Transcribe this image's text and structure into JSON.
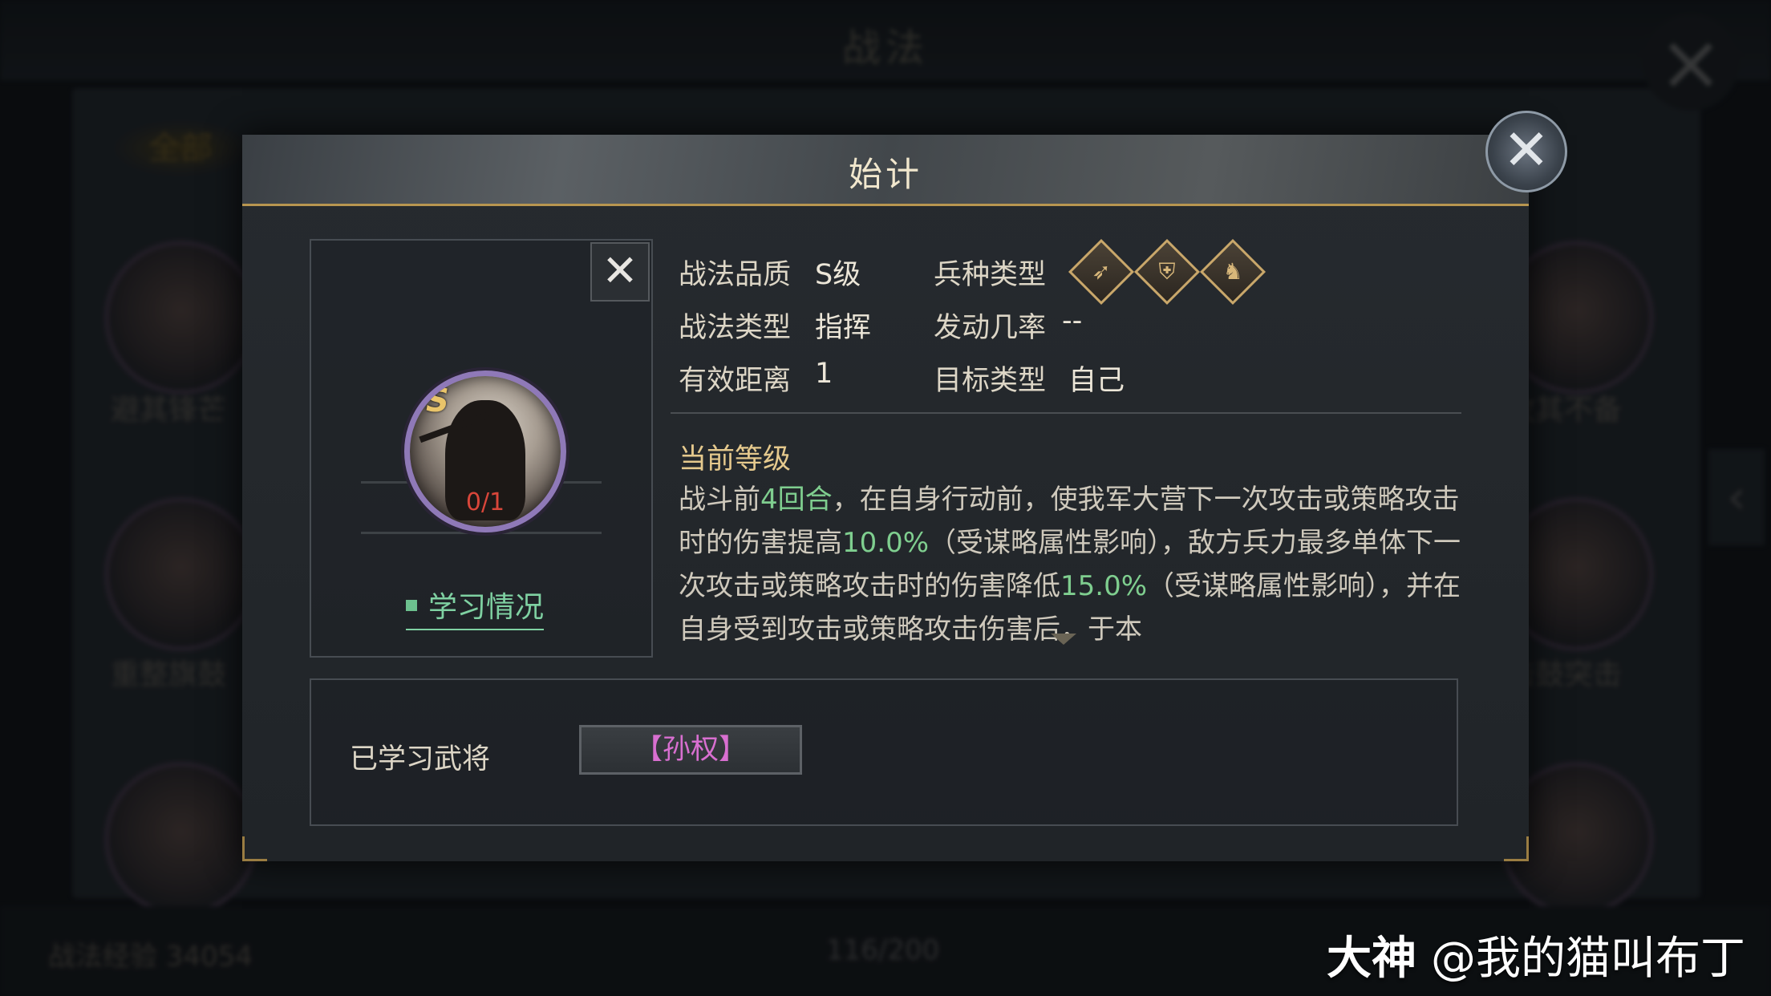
{
  "background": {
    "title": "战法",
    "tab_all": "全部",
    "cards": [
      {
        "label": "避其锋芒"
      },
      {
        "label": "攻其不备"
      },
      {
        "label": "重整旗鼓"
      },
      {
        "label": "击鼓突击"
      }
    ],
    "exp_text": "战法经验 34054",
    "count_text": "116/200"
  },
  "dialog": {
    "title": "始计",
    "skill_grade_badge": "S",
    "learn_count": "0/1",
    "learn_status_label": "学习情况",
    "attributes": {
      "quality_label": "战法品质",
      "quality_value": "S级",
      "troop_label": "兵种类型",
      "troop_icons": [
        "archer-icon",
        "shield-infantry-icon",
        "cavalry-icon"
      ],
      "type_label": "战法类型",
      "type_value": "指挥",
      "trigger_label": "发动几率",
      "trigger_value": "--",
      "range_label": "有效距离",
      "range_value": "1",
      "target_label": "目标类型",
      "target_value": "自己"
    },
    "current_level_title": "当前等级",
    "description": {
      "part1": "战斗前",
      "rounds": "4回合",
      "part2": "，在自身行动前，使我军大营下一次攻击或策略攻击时的伤害提高",
      "boost": "10.0%",
      "part3": "（受谋略属性影响），敌方兵力最多单体下一次攻击或策略攻击时的伤害降低",
      "reduce": "15.0%",
      "part4": "（受谋略属性影响），并在自身受到攻击或策略攻击伤害后，于本"
    },
    "learned_label": "已学习武将",
    "learned_general": "【孙权】"
  },
  "watermark": {
    "brand": "大神",
    "handle": "@我的猫叫布丁"
  },
  "colors": {
    "accent_gold": "#b89650",
    "highlight_green": "#7fce8f",
    "general_pink": "#d86fd0"
  }
}
